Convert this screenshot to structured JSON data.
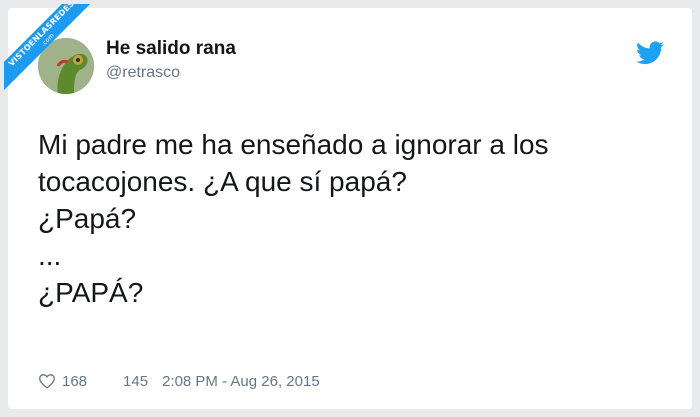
{
  "watermark": {
    "text": "VISTOENLASREDES",
    "sub": ".com"
  },
  "author": {
    "name": "He salido rana",
    "handle": "@retrasco"
  },
  "tweet": {
    "lines": [
      "Mi padre me ha enseñado a ignorar a los",
      "tocacojones. ¿A que sí papá?",
      "¿Papá?",
      "...",
      "¿PAPÁ?"
    ]
  },
  "stats": {
    "likes": "168",
    "replies": "145",
    "timestamp": "2:08 PM - Aug 26, 2015"
  },
  "icons": {
    "brand": "twitter-bird-icon",
    "like": "heart-icon"
  },
  "colors": {
    "brand": "#1da1f2",
    "muted": "#657786",
    "text": "#14171a"
  }
}
